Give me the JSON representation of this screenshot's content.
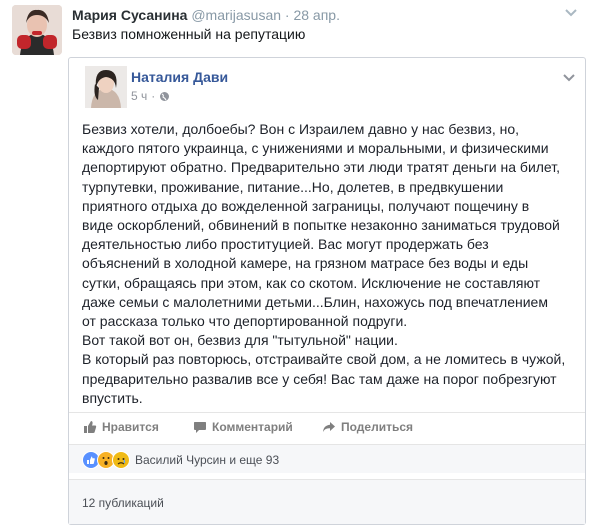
{
  "tweet": {
    "author_name": "Мария Сусанина",
    "author_handle": "@marijasusan",
    "separator": "·",
    "date": "28 апр.",
    "text": "Безвиз помноженный на репутацию"
  },
  "fb_post": {
    "author_name": "Наталия Дави",
    "time": "5 ч",
    "meta_separator": "·",
    "body": "Безвиз хотели, долбоебы? Вон с Израилем давно у нас безвиз, но,\nкаждого пятого украинца, с унижениями и моральными, и физическими\nдепортируют обратно. Предварительно эти люди тратят деньги на билет,\nтурпутевки, проживание, питание...Но, долетев, в предвкушении\nприятного отдыха до вожделенной заграницы, получают пощечину в\nвиде оскорблений, обвинений в попытке незаконно заниматься трудовой\nдеятельностью либо проституцией. Вас могут продержать без\nобъяснений в холодной камере, на грязном матрасе без воды и еды\nсутки, обращаясь при этом, как со скотом. Исключение не составляют\nдаже семьи с малолетними детьми...Блин, нахожусь под впечатлением\nот рассказа только что депортированной подруги.\nВот такой вот он, безвиз для \"тытульной\" нации.\nВ который раз повторюсь, отстраивайте свой дом, а не ломитесь в чужой,\nпредварительно развалив все у себя! Вас там даже на порог побрезгуют\nвпустить.",
    "actions": {
      "like": "Нравится",
      "comment": "Комментарий",
      "share": "Поделиться"
    },
    "reactions_text": "Василий Чурсин и еще 93",
    "shares_text": "12 публикаций",
    "colors": {
      "link_blue": "#365899",
      "like_blue": "#5890ff",
      "wow_yellow": "#f7b125",
      "sad_yellow": "#f0ba15"
    }
  }
}
